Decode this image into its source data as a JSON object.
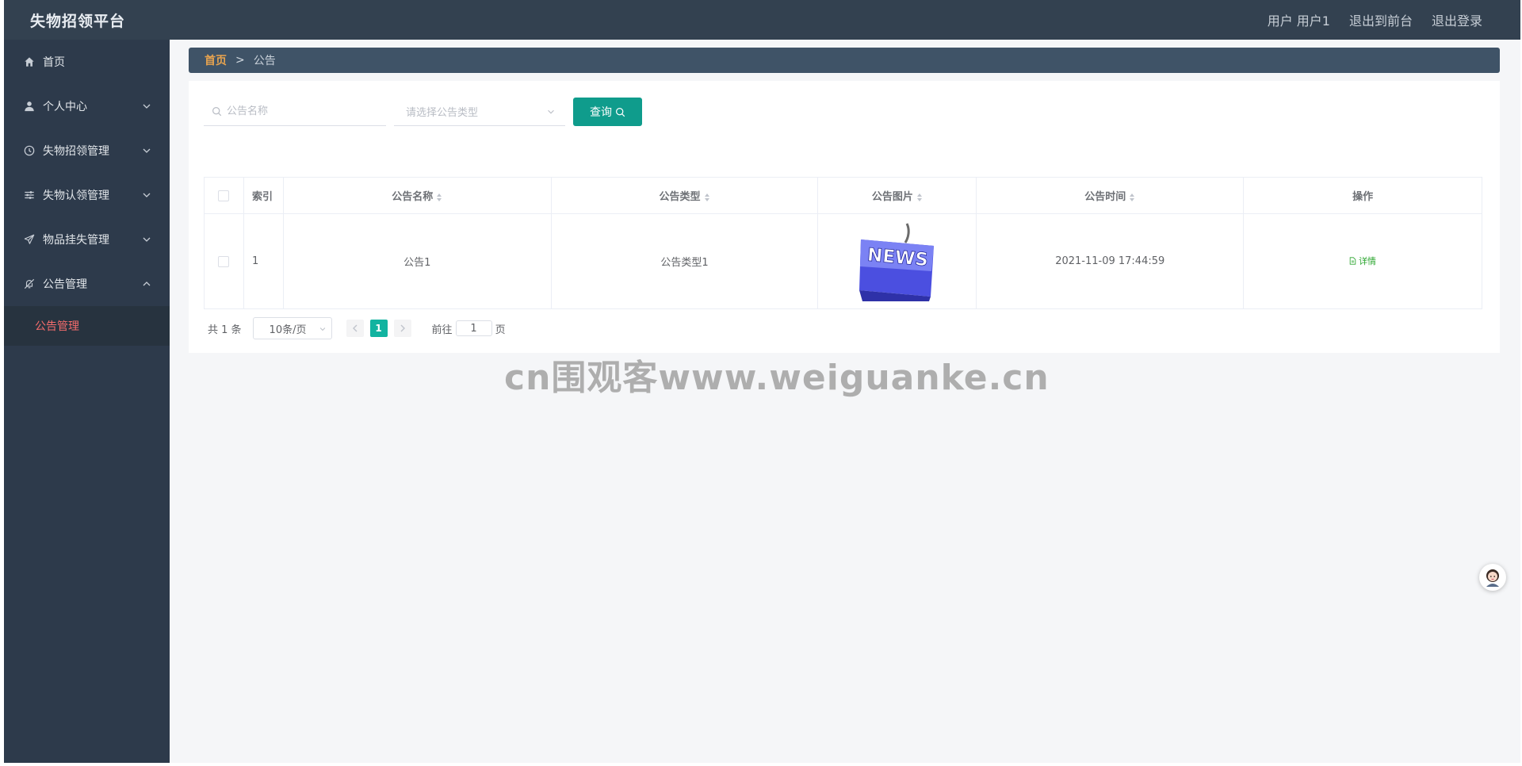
{
  "header": {
    "brand": "失物招领平台",
    "actions": [
      {
        "label": "用户 用户1"
      },
      {
        "label": "退出到前台"
      },
      {
        "label": "退出登录"
      }
    ]
  },
  "sidebar": {
    "items": [
      {
        "label": "首页",
        "icon": "home-icon"
      },
      {
        "label": "个人中心",
        "icon": "user-icon"
      },
      {
        "label": "失物招领管理",
        "icon": "clock-icon"
      },
      {
        "label": "失物认领管理",
        "icon": "sliders-icon"
      },
      {
        "label": "物品挂失管理",
        "icon": "send-icon"
      },
      {
        "label": "公告管理",
        "icon": "bell-off-icon",
        "expanded": true
      }
    ],
    "subitems": [
      {
        "label": "公告管理",
        "active_color": "#f56c6c"
      }
    ]
  },
  "breadcrumb": {
    "home": "首页",
    "separator": ">",
    "current": "公告"
  },
  "search": {
    "name_placeholder": "公告名称",
    "type_placeholder": "请选择公告类型",
    "query_label": "查询"
  },
  "table": {
    "headers": [
      "索引",
      "公告名称",
      "公告类型",
      "公告图片",
      "公告时间",
      "操作"
    ],
    "rows": [
      {
        "index": "1",
        "name": "公告1",
        "type": "公告类型1",
        "image_text": "NEWS",
        "time": "2021-11-09 17:44:59",
        "action": "详情"
      }
    ]
  },
  "pagination": {
    "total": "共 1 条",
    "page_size": "10条/页",
    "current_page": "1",
    "goto_label": "前往",
    "goto_value": "1",
    "page_suffix": "页"
  },
  "watermark": "cn围观客www.weiguanke.cn",
  "colors": {
    "topbar": "#334150",
    "sidebar": "#2d3a4b",
    "accent": "#0f9c8c",
    "active_menu": "#f56c6c",
    "breadcrumb_home": "#e8a44f"
  }
}
